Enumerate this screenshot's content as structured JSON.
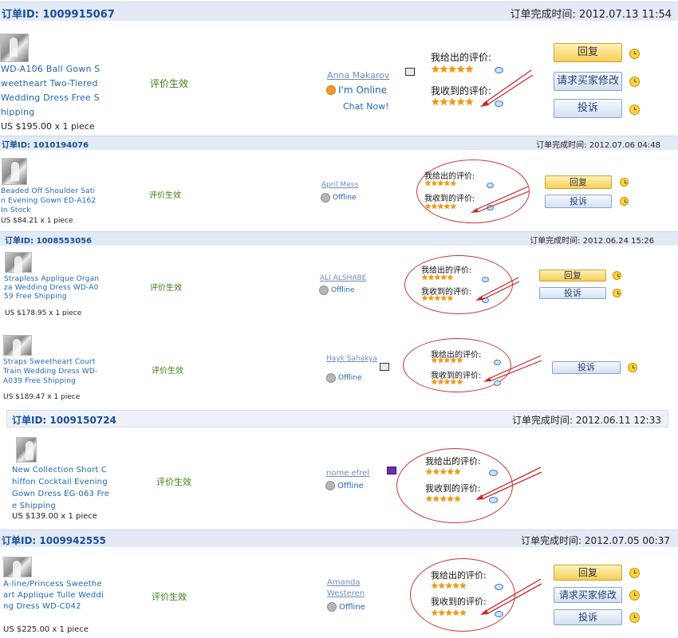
{
  "status_text": "评价生效",
  "rating_given_label": "我给出的评价:",
  "rating_received_label": "我收到的评价:",
  "stars_glyph": "★★★★★",
  "accent_color": "#1a4f9a",
  "star_color": "#f39a0a",
  "orders": [
    {
      "order_id": "订单ID: 1009915067",
      "completed": "订单完成时间: 2012.07.13 11:54",
      "product": "WD-A106 Ball Gown Sweetheart Two-Tiered Wedding Dress Free Shipping",
      "price": "US $195.00 x 1 piece",
      "buyer": "Anna Makarov",
      "presence": "I'm Online",
      "chat": "Chat Now!",
      "buttons": [
        "回复",
        "请求买家修改",
        "投诉"
      ]
    },
    {
      "order_id": "订单ID: 1010194076",
      "completed": "订单完成时间: 2012.07.06 04:48",
      "product": "Beaded Off Shoulder Satin Evening Gown ED-A162 In Stock",
      "price": "US $84.21 x 1 piece",
      "buyer": "April Mess",
      "presence": "Offline",
      "buttons": [
        "回复",
        "投诉"
      ]
    },
    {
      "order_id": "订单ID: 1008553056",
      "completed": "订单完成时间: 2012.06.24 15:26",
      "product": "Strapless Applique Organza Wedding Dress WD-A059 Free Shipping",
      "price": "US $178.95 x 1 piece",
      "buyer": "ALI ALSHABE",
      "presence": "Offline",
      "buttons": [
        "回复",
        "投诉"
      ]
    },
    {
      "order_id": "",
      "completed": "",
      "product": "Straps Sweetheart Court Train Wedding Dress WD-A039 Free Shipping",
      "price": "US $189.47 x 1 piece",
      "buyer": "Hayk Sahakya",
      "presence": "Offline",
      "buttons": [
        "投诉"
      ]
    },
    {
      "order_id": "订单ID: 1009150724",
      "completed": "订单完成时间: 2012.06.11 12:33",
      "product": "New Collection Short Chiffon Cocktail Evening Gown Dress EG-063 Free Shipping",
      "price": "US $139.00 x 1 piece",
      "buyer": "nome efrel",
      "presence": "Offline",
      "buttons": []
    },
    {
      "order_id": "订单ID: 1009942555",
      "completed": "订单完成时间: 2012.07.05 00:37",
      "product": "A-line/Princess Sweetheart Applique Tulle Wedding Dress WD-C042",
      "price": "US $225.00 x 1 piece",
      "buyer": "Amanda Westeren",
      "presence": "Offline",
      "buttons": [
        "回复",
        "请求买家修改",
        "投诉"
      ]
    }
  ]
}
